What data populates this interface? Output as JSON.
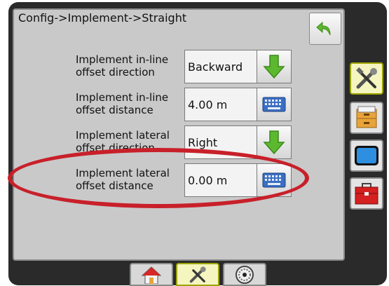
{
  "header": {
    "title": "Config->Implement->Straight"
  },
  "fields": [
    {
      "label_line1": "Implement in-line",
      "label_line2": "offset direction",
      "value": "Backward",
      "action_icon": "down-arrow-icon"
    },
    {
      "label_line1": "Implement in-line",
      "label_line2": "offset distance",
      "value": "4.00 m",
      "action_icon": "keyboard-icon"
    },
    {
      "label_line1": "Implement lateral",
      "label_line2": "offset direction",
      "value": "Right",
      "action_icon": "down-arrow-icon"
    },
    {
      "label_line1": "Implement lateral",
      "label_line2": "offset distance",
      "value": "0.00 m",
      "action_icon": "keyboard-icon"
    }
  ],
  "side_tabs": [
    {
      "icon": "tools-icon",
      "active": true
    },
    {
      "icon": "file-cabinet-icon",
      "active": false
    },
    {
      "icon": "display-icon",
      "active": false
    },
    {
      "icon": "toolbox-icon",
      "active": false
    }
  ],
  "bottom_tabs": [
    {
      "icon": "home-icon",
      "active": false
    },
    {
      "icon": "tools-icon",
      "active": true
    },
    {
      "icon": "gauge-icon",
      "active": false
    }
  ],
  "colors": {
    "highlight": "#c8202a",
    "active_tab": "#f5f5c0",
    "arrow_green": "#5cb82e"
  }
}
